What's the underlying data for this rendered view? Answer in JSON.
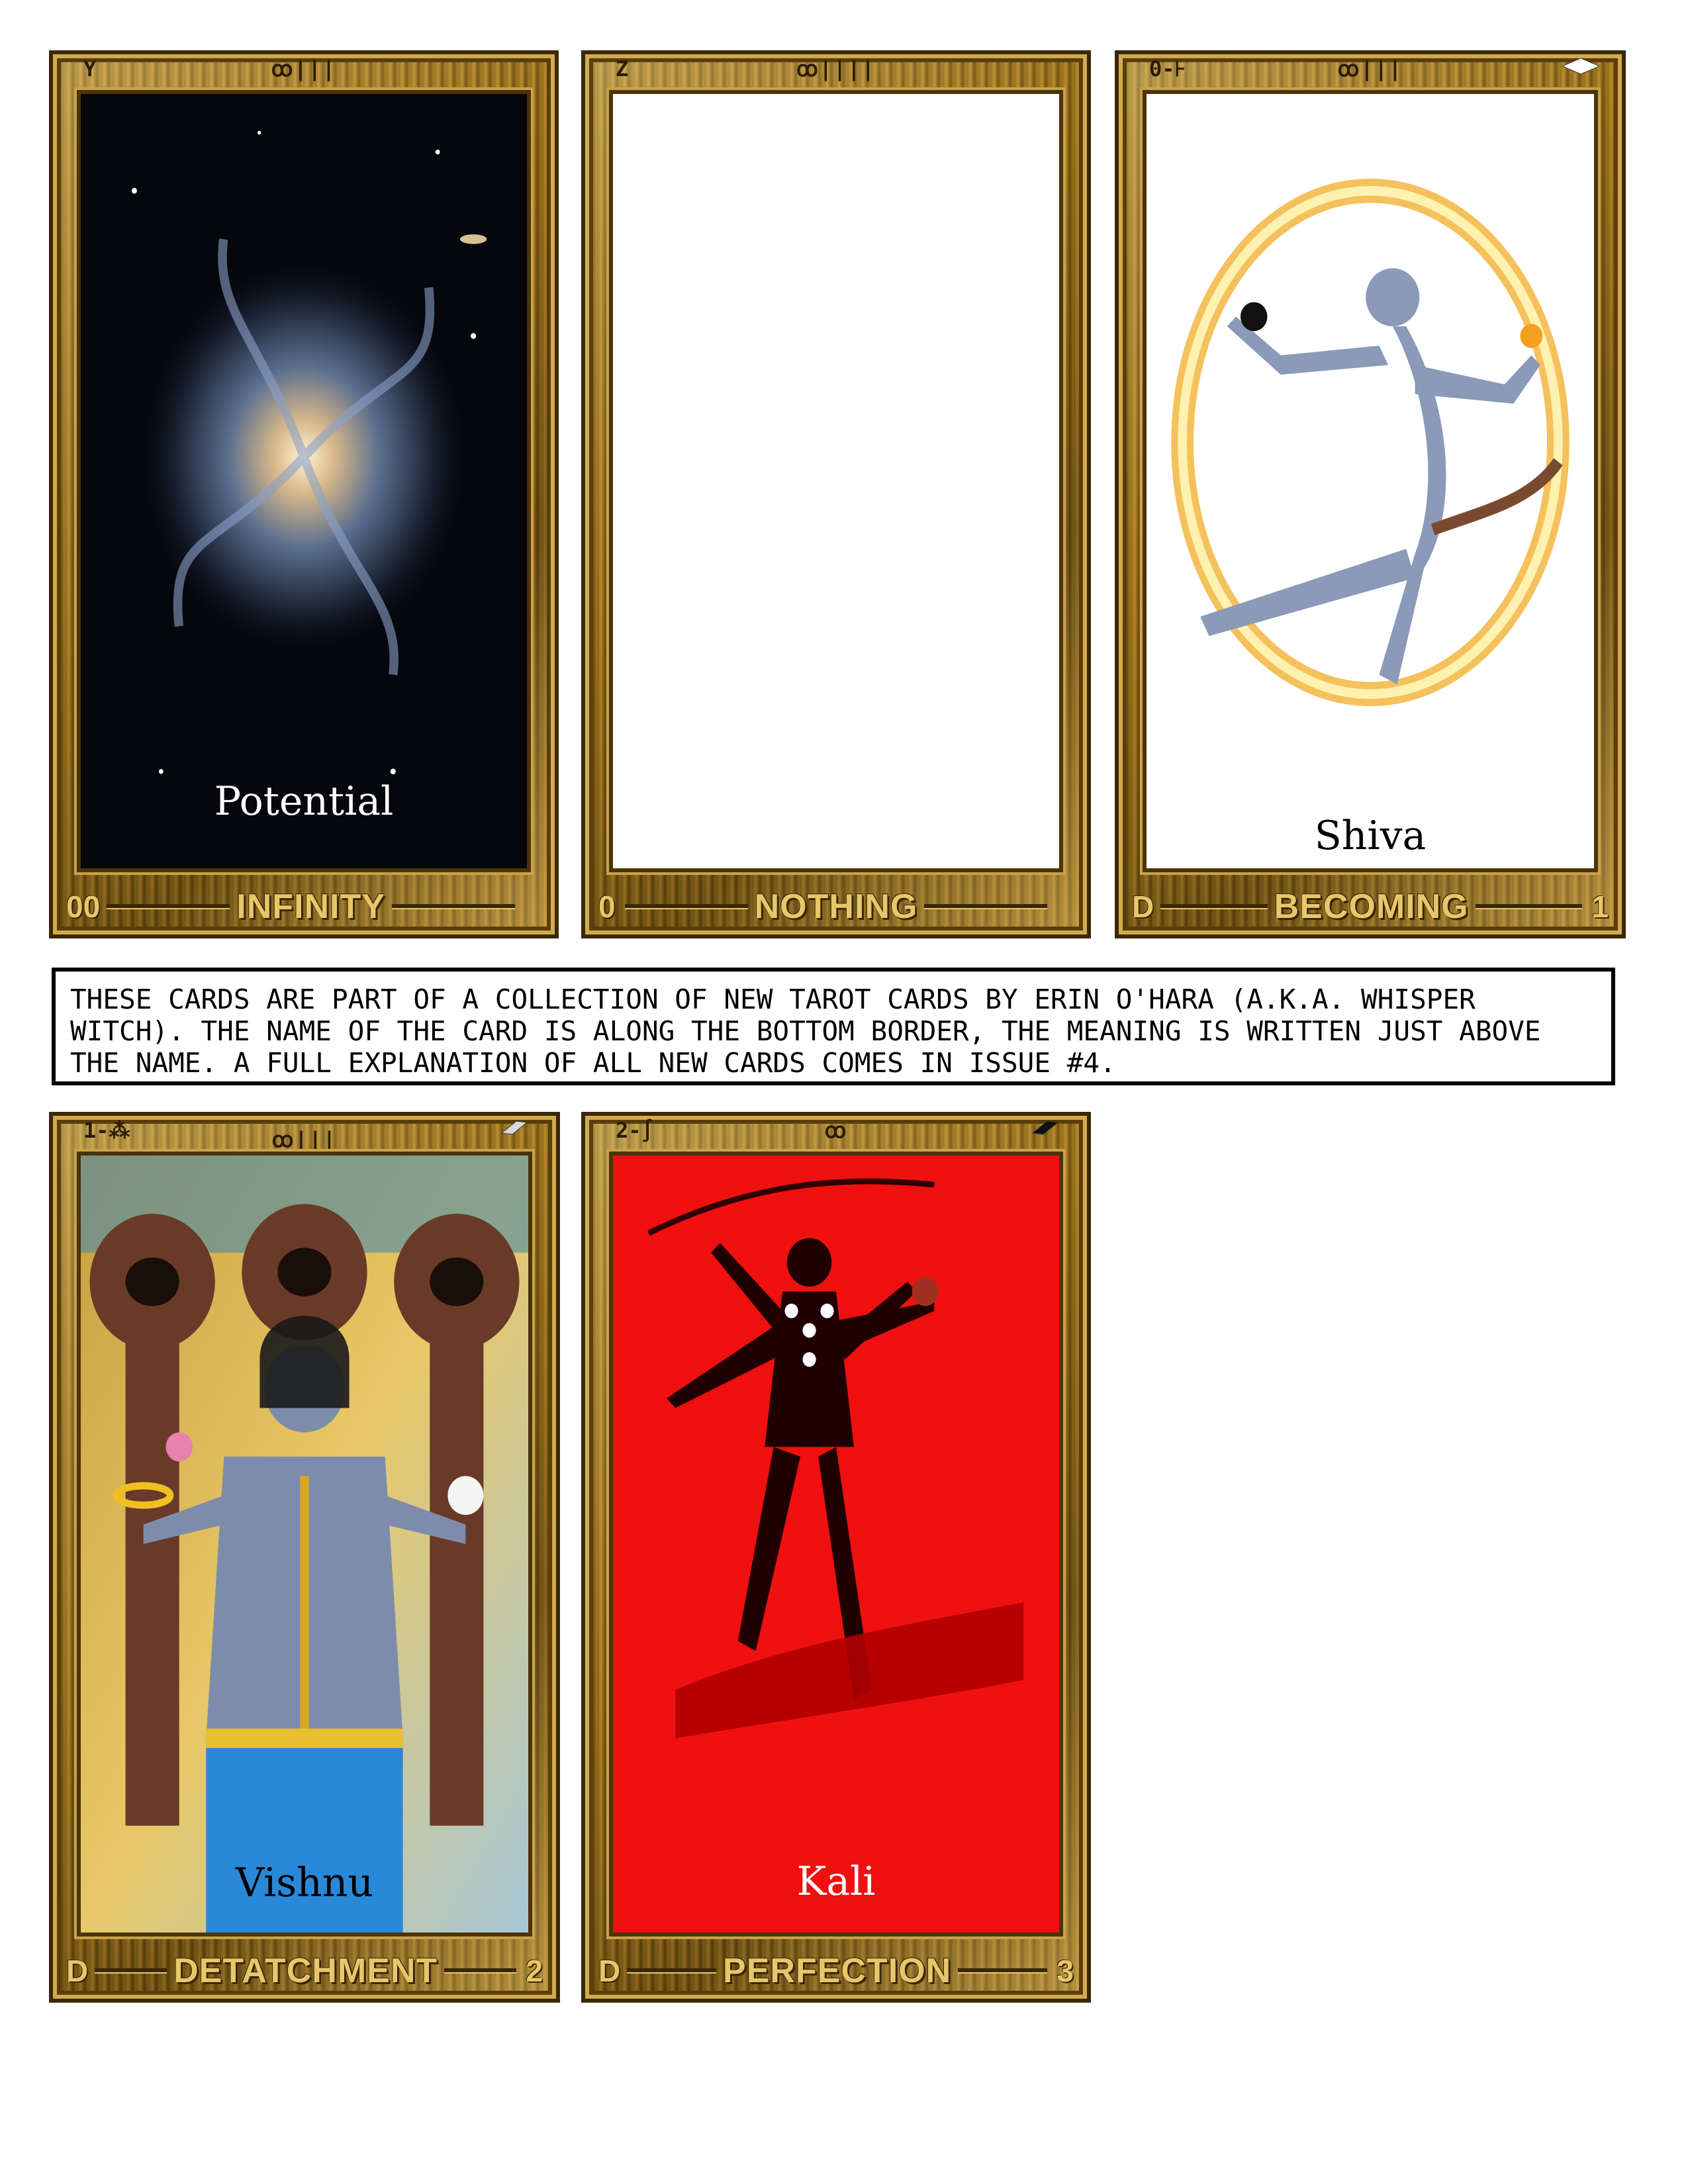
{
  "cards": [
    {
      "top_left": "Y",
      "top_center": "ꝏ|||",
      "meaning": "Potential",
      "corner_left": "00",
      "name": "INFINITY",
      "corner_right": "",
      "meaning_color": "#ffffff"
    },
    {
      "top_left": "Z",
      "top_center": "ꝏ||||",
      "meaning": "",
      "corner_left": "0",
      "name": "NOTHING",
      "corner_right": "",
      "meaning_color": "#000000"
    },
    {
      "top_left": "0-⊦",
      "top_center": "ꝏ|||",
      "meaning": "Shiva",
      "corner_left": "D",
      "name": "BECOMING",
      "corner_right": "1",
      "meaning_color": "#000000"
    },
    {
      "top_left": "1-⁂",
      "top_center": "ꝏ|||",
      "meaning": "Vishnu",
      "corner_left": "D",
      "name": "DETATCHMENT",
      "corner_right": "2",
      "meaning_color": "#000000"
    },
    {
      "top_left": "2-∫",
      "top_center": "ꝏ",
      "meaning": "Kali",
      "corner_left": "D",
      "name": "PERFECTION",
      "corner_right": "3",
      "meaning_color": "#ffffff"
    }
  ],
  "caption": "THESE CARDS ARE PART OF A COLLECTION OF NEW TAROT CARDS BY ERIN O'HARA (A.K.A. WHISPER WITCH). THE NAME OF THE CARD IS ALONG THE BOTTOM BORDER, THE MEANING IS WRITTEN JUST ABOVE THE NAME. A FULL EXPLANATION OF ALL NEW CARDS COMES IN ISSUE #4."
}
